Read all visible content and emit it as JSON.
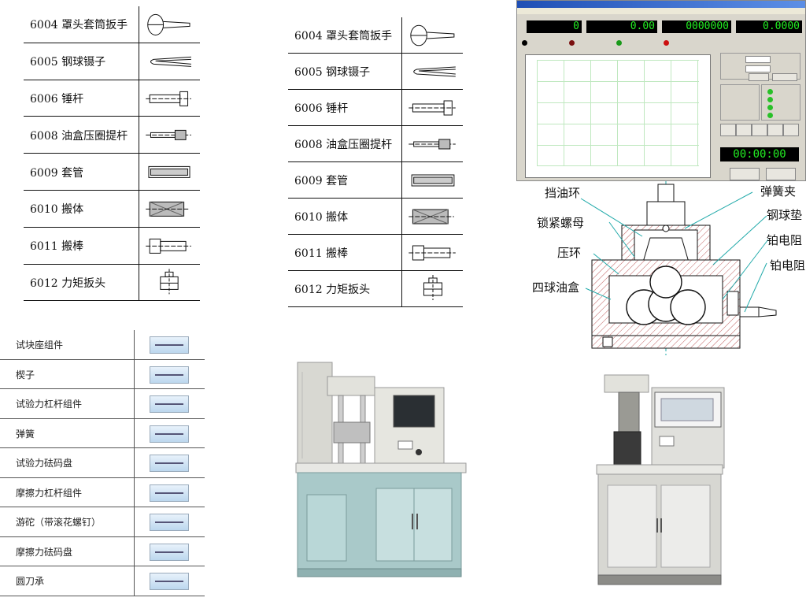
{
  "parts_table_left": {
    "rows": [
      {
        "label": "6004 罩头套筒扳手",
        "icon": "socket-wrench-icon"
      },
      {
        "label": "6005 钢球镊子",
        "icon": "ball-tweezers-icon"
      },
      {
        "label": "6006 锤杆",
        "icon": "hammer-rod-icon"
      },
      {
        "label": "6008 油盒压圈提杆",
        "icon": "lift-rod-icon"
      },
      {
        "label": "6009 套管",
        "icon": "sleeve-icon"
      },
      {
        "label": "6010 搬体",
        "icon": "wrench-body-icon"
      },
      {
        "label": "6011 搬棒",
        "icon": "wrench-bar-icon"
      },
      {
        "label": "6012 力矩扳头",
        "icon": "torque-head-icon"
      }
    ]
  },
  "parts_table_mid": {
    "rows": [
      {
        "label": "6004 罩头套筒扳手",
        "icon": "socket-wrench-icon"
      },
      {
        "label": "6005 钢球镊子",
        "icon": "ball-tweezers-icon"
      },
      {
        "label": "6006 锤杆",
        "icon": "hammer-rod-icon"
      },
      {
        "label": "6008 油盒压圈提杆",
        "icon": "lift-rod-icon"
      },
      {
        "label": "6009 套管",
        "icon": "sleeve-icon"
      },
      {
        "label": "6010 搬体",
        "icon": "wrench-body-icon"
      },
      {
        "label": "6011 搬棒",
        "icon": "wrench-bar-icon"
      },
      {
        "label": "6012 力矩扳头",
        "icon": "torque-head-icon"
      }
    ]
  },
  "accessories": [
    {
      "label": "试块座组件"
    },
    {
      "label": "楔子"
    },
    {
      "label": "试验力杠杆组件"
    },
    {
      "label": "弹簧"
    },
    {
      "label": "试验力砝码盘"
    },
    {
      "label": "摩擦力杠杆组件"
    },
    {
      "label": "游砣（带滚花螺钉）"
    },
    {
      "label": "摩擦力砝码盘"
    },
    {
      "label": "圆刀承"
    }
  ],
  "software": {
    "readouts": [
      "0",
      "0.00",
      "0000000",
      "0.0000"
    ],
    "timer": "00:00:00"
  },
  "diagram": {
    "labels": {
      "oil_ring": "挡油环",
      "spring_clip": "弹簧夹",
      "lock_nut": "锁紧螺母",
      "ball_pad": "钢球垫",
      "pressure_ring": "压环",
      "pt_resistor_1": "铂电阻",
      "pt_resistor_2": "铂电阻",
      "four_ball_cup": "四球油盒"
    }
  },
  "colors": {
    "machine_body": "#a9c9c9",
    "machine_upper": "#d8d8d2",
    "led_green": "#22ee22"
  }
}
